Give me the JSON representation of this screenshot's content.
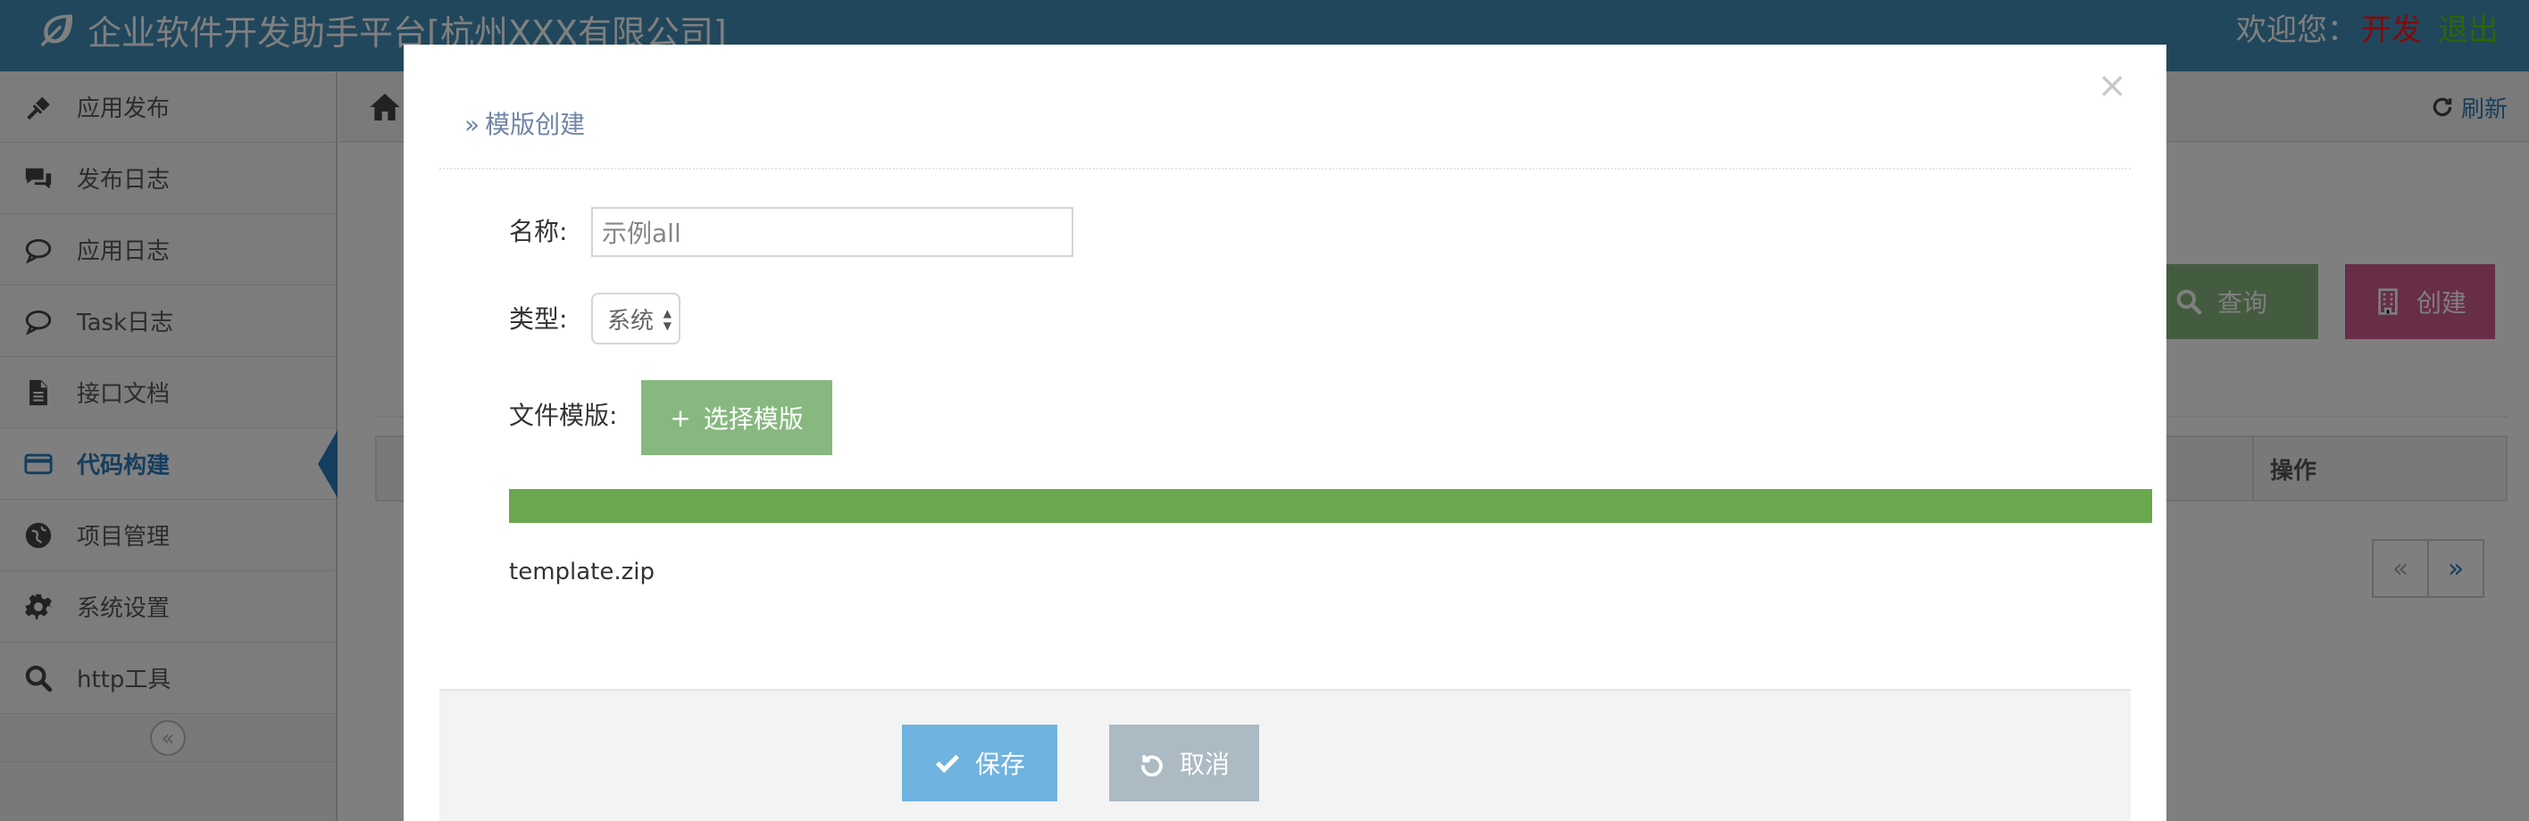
{
  "header": {
    "title": "企业软件开发助手平台[杭州XXX有限公司]",
    "welcome": "欢迎您：",
    "user": "开发",
    "logout": "退出",
    "brand_icon": "leaf-icon"
  },
  "sidebar": {
    "items": [
      {
        "label": "应用发布",
        "icon": "gavel-icon"
      },
      {
        "label": "发布日志",
        "icon": "comments-icon"
      },
      {
        "label": "应用日志",
        "icon": "comment-outline-icon"
      },
      {
        "label": "Task日志",
        "icon": "comment-outline-icon"
      },
      {
        "label": "接口文档",
        "icon": "file-icon"
      },
      {
        "label": "代码构建",
        "icon": "credit-card-icon",
        "active": true
      },
      {
        "label": "项目管理",
        "icon": "globe-icon"
      },
      {
        "label": "系统设置",
        "icon": "gear-icon"
      },
      {
        "label": "http工具",
        "icon": "search-icon"
      }
    ],
    "collapse": "«"
  },
  "main": {
    "refresh": "刷新",
    "query_button": "查询",
    "create_button": "创建",
    "table_header_ops": "操作",
    "pager_prev": "«",
    "pager_next": "»"
  },
  "modal": {
    "title": "模版创建",
    "close": "×",
    "name_label": "名称:",
    "name_value": "示例all",
    "type_label": "类型:",
    "type_value": "系统",
    "file_label": "文件模版:",
    "choose_button": "选择模版",
    "progress": 1.0,
    "file_name": "template.zip",
    "save_button": "保存",
    "cancel_button": "取消"
  },
  "colors": {
    "header": "#438eb9",
    "accent": "#2b7dbc",
    "success": "#87b87f",
    "progress": "#6aa84f",
    "danger": "#d15b8f",
    "save": "#6fb3e0",
    "cancel": "#abbac3"
  }
}
